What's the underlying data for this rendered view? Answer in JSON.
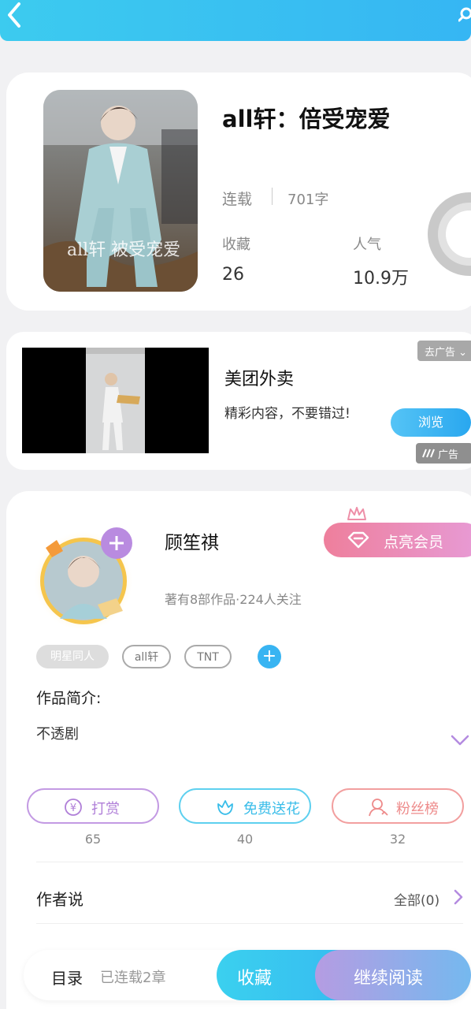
{
  "book": {
    "title": "all轩：倍受宠爱",
    "status": "连载",
    "word_count": "701字",
    "favorites_label": "收藏",
    "favorites_value": "26",
    "popularity_label": "人气",
    "popularity_value": "10.9万",
    "cover_text": "all轩 被受宠爱"
  },
  "ad": {
    "title": "美团外卖",
    "description": "精彩内容，不要错过!",
    "close_label": "去广告",
    "browse_label": "浏览",
    "badge_label": "广告"
  },
  "author": {
    "name": "顾笙祺",
    "stats": "著有8部作品·224人关注",
    "vip_label": "点亮会员",
    "tags": [
      "明星同人",
      "all轩",
      "TNT"
    ],
    "add_tag": "+"
  },
  "intro": {
    "label": "作品简介:",
    "text": "不透剧"
  },
  "actions": [
    {
      "label": "打赏",
      "count": "65",
      "icon_symbol": "¥"
    },
    {
      "label": "免费送花",
      "count": "40"
    },
    {
      "label": "粉丝榜",
      "count": "32"
    }
  ],
  "author_says": {
    "label": "作者说",
    "all_label": "全部(0)"
  },
  "bottom": {
    "toc_label": "目录",
    "chapters_label": "已连载2章",
    "collect_label": "收藏",
    "read_label": "继续阅读"
  },
  "colors": {
    "header": "#36b6f3",
    "vip": "#ee7f9c",
    "reward": "#b07fd8",
    "flower": "#39bde9",
    "fans": "#ee8b8b",
    "collect": "#3bd0ef",
    "read": "#b59ce2"
  }
}
